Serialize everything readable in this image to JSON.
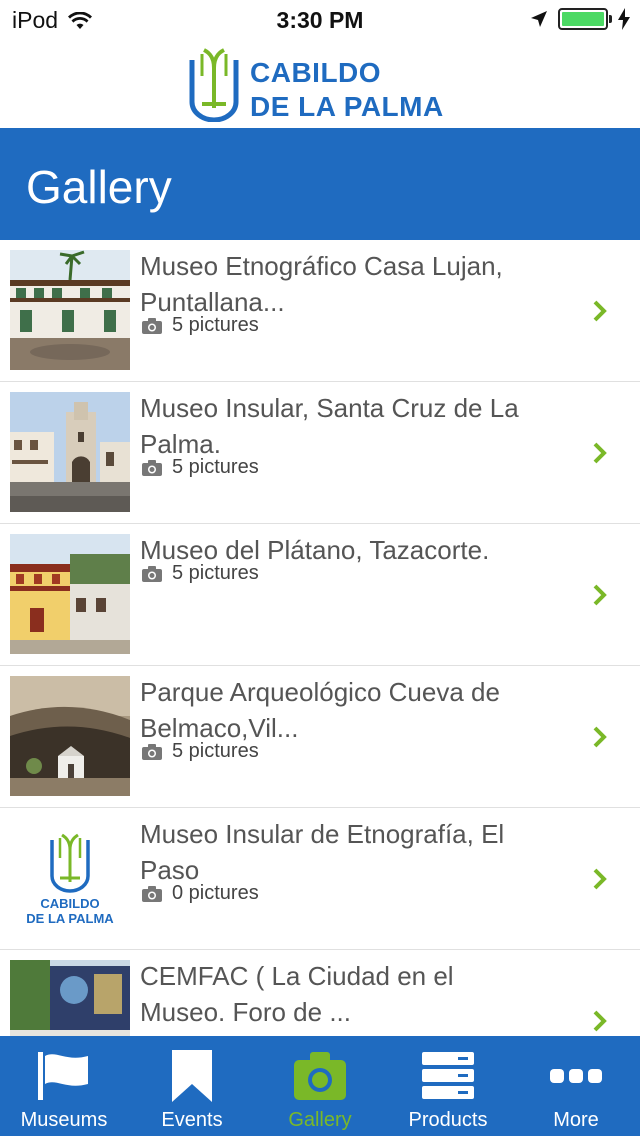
{
  "status_bar": {
    "carrier": "iPod",
    "time": "3:30 PM"
  },
  "header": {
    "logo_line1": "CABILDO",
    "logo_line2": "DE LA PALMA"
  },
  "page": {
    "title": "Gallery"
  },
  "gallery": {
    "items": [
      {
        "title": "Museo Etnográfico Casa Lujan, Puntallana...",
        "pictures": "5 pictures",
        "thumb": "building-balconies"
      },
      {
        "title": "Museo Insular, Santa Cruz de La Palma.",
        "pictures": "5 pictures",
        "thumb": "church-plaza"
      },
      {
        "title": "Museo del Plátano, Tazacorte.",
        "pictures": "5 pictures",
        "thumb": "yellow-house"
      },
      {
        "title": "Parque Arqueológico Cueva de Belmaco,Vil...",
        "pictures": "5 pictures",
        "thumb": "cave"
      },
      {
        "title": "Museo Insular de Etnografía, El Paso",
        "pictures": "0 pictures",
        "thumb": "cabildo-logo",
        "logo_line1": "CABILDO",
        "logo_line2": "DE LA PALMA"
      },
      {
        "title": "CEMFAC ( La Ciudad en el Museo. Foro de ...",
        "pictures": "",
        "thumb": "mural-wall"
      }
    ]
  },
  "tab_bar": {
    "tabs": [
      {
        "label": "Museums",
        "icon": "flag-icon"
      },
      {
        "label": "Events",
        "icon": "bookmark-icon"
      },
      {
        "label": "Gallery",
        "icon": "camera-icon",
        "active": true
      },
      {
        "label": "Products",
        "icon": "server-icon"
      },
      {
        "label": "More",
        "icon": "more-dots-icon"
      }
    ]
  },
  "colors": {
    "primary_blue": "#1f6bc0",
    "accent_green": "#7ab828",
    "battery_green": "#4cd964"
  }
}
